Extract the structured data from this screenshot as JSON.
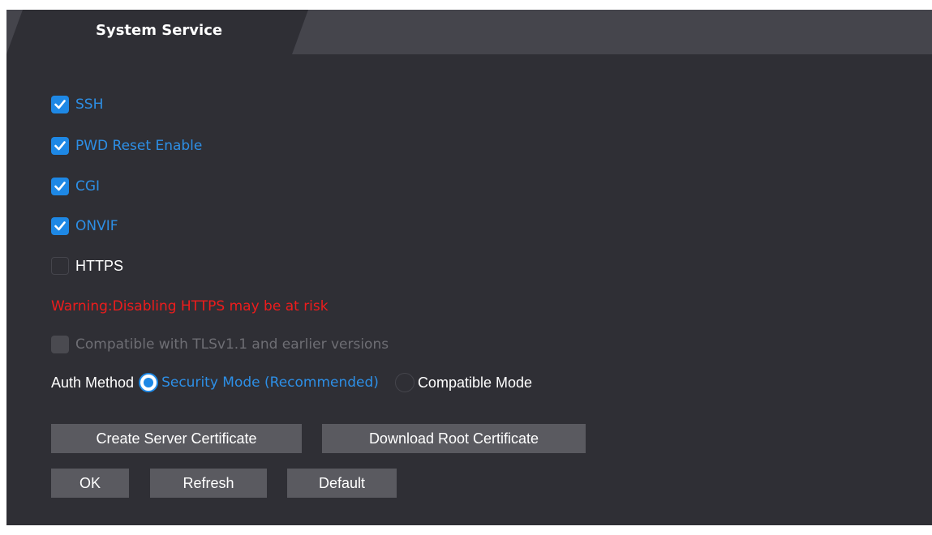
{
  "tab": {
    "title": "System Service"
  },
  "services": {
    "ssh": {
      "label": "SSH",
      "checked": true
    },
    "pwd_reset": {
      "label": "PWD Reset Enable",
      "checked": true
    },
    "cgi": {
      "label": "CGI",
      "checked": true
    },
    "onvif": {
      "label": "ONVIF",
      "checked": true
    },
    "https": {
      "label": "HTTPS",
      "checked": false
    }
  },
  "warning": "Warning:Disabling HTTPS may be at risk",
  "tls_compat": {
    "label": "Compatible with TLSv1.1 and earlier versions",
    "checked": false,
    "disabled": true
  },
  "auth_method": {
    "label": "Auth Method",
    "options": [
      {
        "label": "Security Mode (Recommended)",
        "selected": true
      },
      {
        "label": "Compatible Mode",
        "selected": false
      }
    ]
  },
  "buttons": {
    "create_cert": "Create Server Certificate",
    "download_root": "Download Root Certificate",
    "ok": "OK",
    "refresh": "Refresh",
    "default": "Default"
  },
  "colors": {
    "accent": "#1e88e5",
    "warning": "#ee1c1c",
    "background": "#2f2f35",
    "button": "#5a5a60"
  },
  "icons": {
    "checkbox_checked": "checkmark-icon",
    "radio_selected": "radio-dot-icon"
  }
}
